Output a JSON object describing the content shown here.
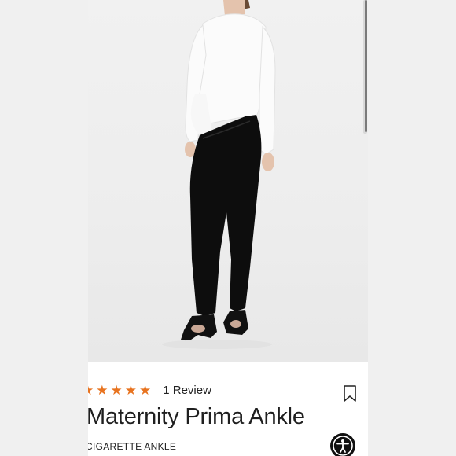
{
  "product": {
    "rating_stars": 5,
    "review_count_label": "1 Review",
    "title": "Maternity Prima Ankle",
    "subtitle": "CIGARETTE ANKLE"
  },
  "icons": {
    "star": "star-icon",
    "bookmark": "bookmark-icon",
    "accessibility": "accessibility-icon"
  },
  "colors": {
    "star": "#e8731f",
    "text": "#1f1f1f",
    "accessibility_button": "#111111"
  }
}
